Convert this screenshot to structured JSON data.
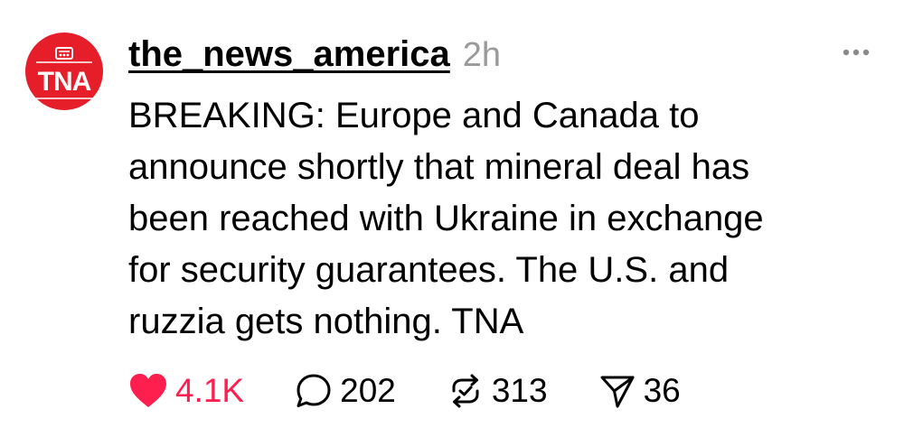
{
  "post": {
    "avatar_text": "TNA",
    "username": "the_news_america",
    "time": "2h",
    "text": "BREAKING: Europe and Canada to\nannounce shortly that mineral deal has\nbeen reached with Ukraine in exchange\nfor security guarantees. The U.S. and\nruzzia gets nothing. TNA",
    "more_icon": "more-horizontal-icon"
  },
  "actions": {
    "likes": "4.1K",
    "comments": "202",
    "reposts": "313",
    "shares": "36",
    "liked": true
  },
  "colors": {
    "avatar_bg": "#e51e2a",
    "like": "#ff1f4f",
    "muted": "#9a9a9a"
  }
}
